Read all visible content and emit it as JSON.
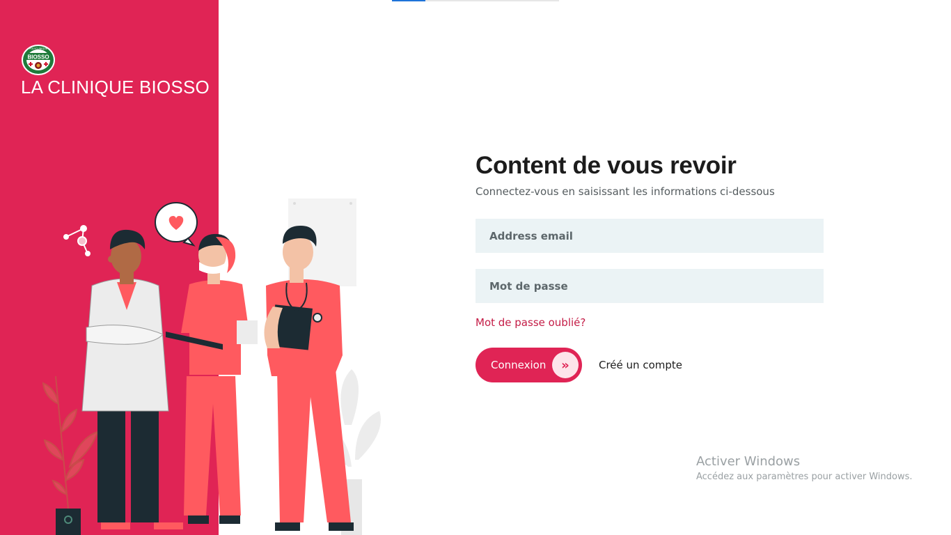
{
  "sidebar": {
    "brand_title": "LA CLINIQUE BIOSSO",
    "logo_name": "polyclinique-biosso-logo",
    "logo_text": "BIOSSO",
    "logo_arc_text": "POLYCLINIQUE",
    "logo_colors": {
      "green": "#1f7a3a",
      "red": "#d0112b"
    },
    "background_color": "#e02455"
  },
  "top_strip": {
    "progress": 0.2,
    "color": "#1e73d9"
  },
  "login": {
    "heading": "Content de vous revoir",
    "subheading": "Connectez-vous en saisissant les informations ci-dessous",
    "email_placeholder": "Address email",
    "password_placeholder": "Mot de passe",
    "forgot_password": "Mot de passe oublié?",
    "login_button": "Connexion",
    "login_button_icon": "double-chevron-right-icon",
    "signup_link": "Créé un compte",
    "accent_color": "#e02455",
    "field_background": "#ebf3f5"
  },
  "watermark": {
    "title": "Activer Windows",
    "subtitle": "Accédez aux paramètres pour activer Windows."
  }
}
